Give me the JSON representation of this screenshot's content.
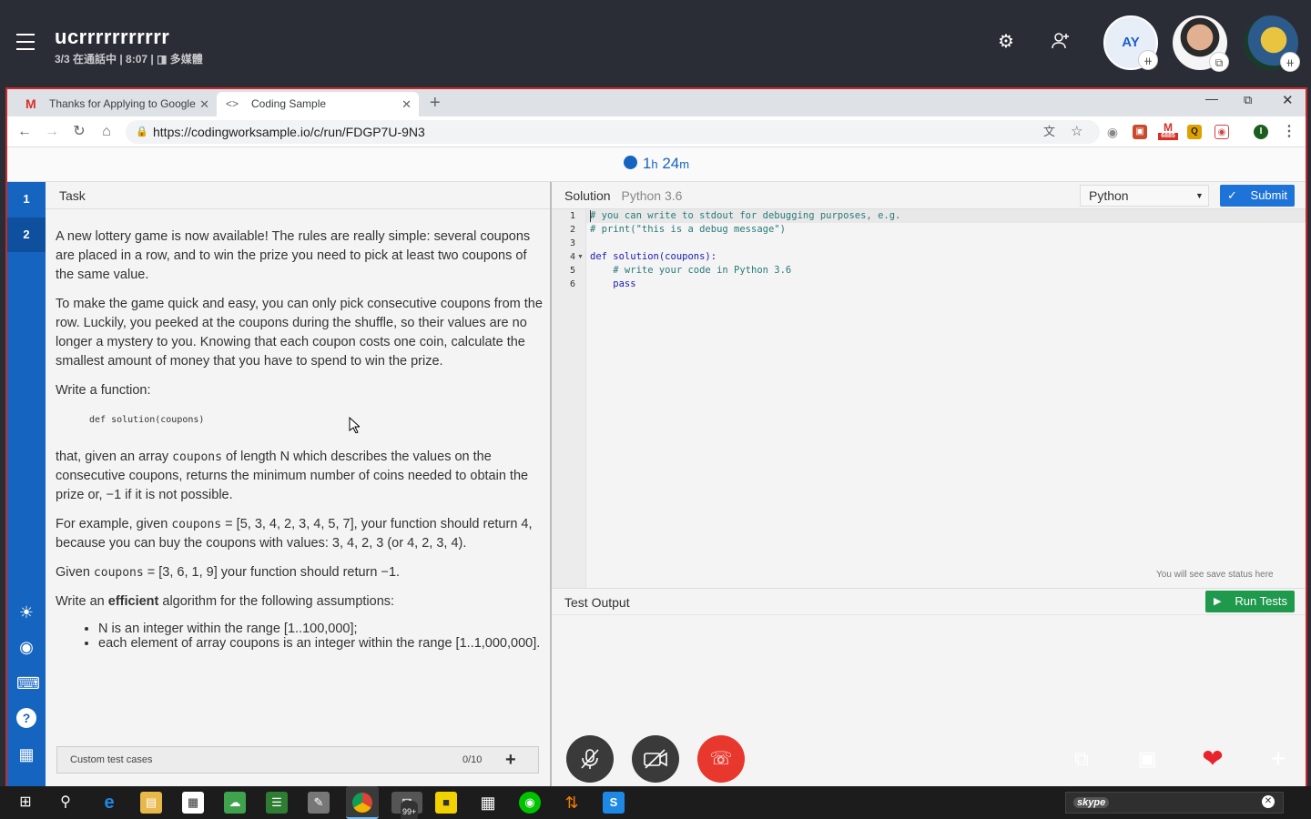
{
  "skype": {
    "call_name": "ucrrrrrrrrrrr",
    "call_status": "3/3 在通話中 | 8:07 |",
    "media_label": "多媒體",
    "avatar_initials": "AY"
  },
  "browser": {
    "tabs": [
      {
        "label": "Thanks for Applying to Google",
        "icon": "gmail-icon"
      },
      {
        "label": "Coding Sample",
        "icon": "code-icon"
      }
    ],
    "url": "https://codingworksample.io/c/run/FDGP7U-9N3",
    "extension_badge": "6885",
    "profile_initial": "I"
  },
  "page": {
    "timer_h": "1",
    "timer_h_unit": "h",
    "timer_m": "24",
    "timer_m_unit": "m",
    "task_numbers": [
      "1",
      "2"
    ],
    "task_header": "Task",
    "task": {
      "p1": "A new lottery game is now available! The rules are really simple: several coupons are placed in a row, and to win the prize you need to pick at least two coupons of the same value.",
      "p2": "To make the game quick and easy, you can only pick consecutive coupons from the row. Luckily, you peeked at the coupons during the shuffle, so their values are no longer a mystery to you. Knowing that each coupon costs one coin, calculate the smallest amount of money that you have to spend to win the prize.",
      "p3": "Write a function:",
      "signature": "def solution(coupons)",
      "p4_a": "that, given an array ",
      "p4_code": "coupons",
      "p4_b": " of length N which describes the values on the consecutive coupons, returns the minimum number of coins needed to obtain the prize or, −1 if it is not possible.",
      "p5_a": "For example, given ",
      "p5_code": "coupons",
      "p5_b": " = [5, 3, 4, 2, 3, 4, 5, 7], your function should return 4, because you can buy the coupons with values: 3, 4, 2, 3 (or 4, 2, 3, 4).",
      "p6_a": "Given ",
      "p6_code": "coupons",
      "p6_b": " = [3, 6, 1, 9] your function should return −1.",
      "p7_a": "Write an ",
      "p7_bold": "efficient",
      "p7_b": " algorithm for the following assumptions:",
      "bullets": [
        "N is an integer within the range [1..100,000];",
        "each element of array coupons is an integer within the range [1..1,000,000]."
      ]
    },
    "custom_tests_label": "Custom test cases",
    "custom_tests_count": "0/10",
    "solution_label": "Solution",
    "solution_lang_version": "Python 3.6",
    "language_selected": "Python",
    "submit_label": "Submit",
    "code_lines": [
      "# you can write to stdout for debugging purposes, e.g.",
      "# print(\"this is a debug message\")",
      "",
      "def solution(coupons):",
      "    # write your code in Python 3.6",
      "    pass"
    ],
    "line_numbers": [
      "1",
      "2",
      "3",
      "4",
      "5",
      "6"
    ],
    "save_status": "You will see save status here",
    "test_output_label": "Test Output",
    "run_tests_label": "Run Tests"
  },
  "taskbar": {
    "mail_badge": "99+",
    "search_box": "skype"
  }
}
